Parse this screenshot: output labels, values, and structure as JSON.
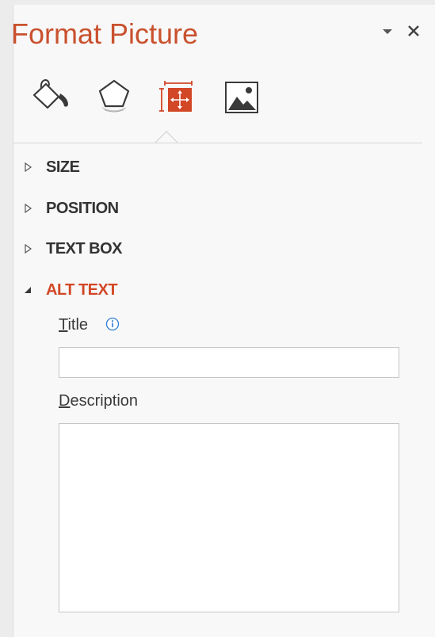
{
  "pane": {
    "title": "Format Picture"
  },
  "toolbar_tabs": [
    {
      "icon": "fill-line-icon",
      "selected": false
    },
    {
      "icon": "effects-icon",
      "selected": false
    },
    {
      "icon": "size-properties-icon",
      "selected": true
    },
    {
      "icon": "picture-icon",
      "selected": false
    }
  ],
  "sections": [
    {
      "label": "SIZE",
      "expanded": false
    },
    {
      "label": "POSITION",
      "expanded": false
    },
    {
      "label": "TEXT BOX",
      "expanded": false
    },
    {
      "label": "ALT TEXT",
      "expanded": true
    }
  ],
  "alt_text": {
    "title_label_accel": "T",
    "title_label_rest": "itle",
    "title_value": "",
    "description_label_accel": "D",
    "description_label_rest": "escription",
    "description_value": ""
  },
  "colors": {
    "accent": "#d24726",
    "title": "#c9512e",
    "info": "#2b7cd3"
  }
}
